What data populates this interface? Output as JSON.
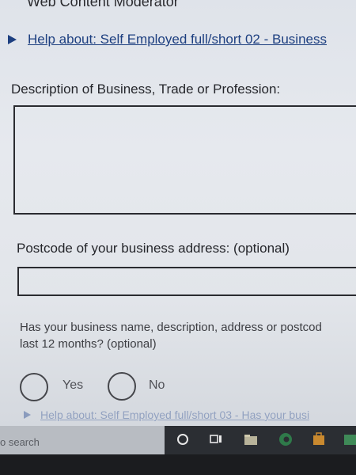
{
  "header": {
    "title": "Web Content Moderator"
  },
  "help_top": {
    "link_text": "Help about: Self Employed full/short 02 - Business"
  },
  "description": {
    "label": "Description of Business, Trade or Profession:",
    "value": ""
  },
  "postcode": {
    "label": "Postcode of your business address: (optional)",
    "value": ""
  },
  "changes": {
    "question_line1": "Has your business name, description, address or postcod",
    "question_line2": "last 12 months? (optional)",
    "options": [
      "Yes",
      "No"
    ]
  },
  "help_bottom": {
    "link_text": "Help about: Self Employed full/short 03 - Has your busi"
  },
  "taskbar": {
    "search_text": "o search"
  },
  "colors": {
    "link": "#1d3f80",
    "taskbar": "#2b2e33",
    "taskbar_search": "#b8bcc2",
    "edge_accent": "#2f7a4a",
    "store_accent": "#c9892f"
  }
}
